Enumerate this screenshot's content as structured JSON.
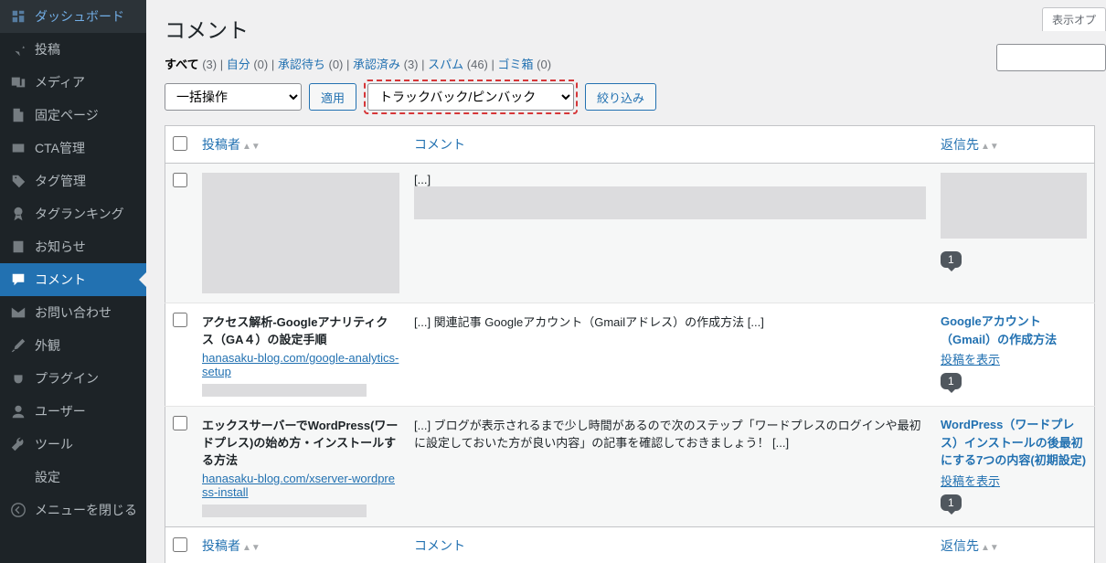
{
  "sidebar": {
    "items": [
      {
        "icon": "dashboard",
        "label": "ダッシュボード"
      },
      {
        "icon": "pin",
        "label": "投稿"
      },
      {
        "icon": "media",
        "label": "メディア"
      },
      {
        "icon": "page",
        "label": "固定ページ"
      },
      {
        "icon": "cta",
        "label": "CTA管理"
      },
      {
        "icon": "tag",
        "label": "タグ管理"
      },
      {
        "icon": "award",
        "label": "タグランキング"
      },
      {
        "icon": "notice",
        "label": "お知らせ"
      },
      {
        "icon": "comment",
        "label": "コメント"
      },
      {
        "icon": "mail",
        "label": "お問い合わせ"
      },
      {
        "icon": "brush",
        "label": "外観"
      },
      {
        "icon": "plugin",
        "label": "プラグイン"
      },
      {
        "icon": "user",
        "label": "ユーザー"
      },
      {
        "icon": "tool",
        "label": "ツール"
      },
      {
        "icon": "settings",
        "label": "設定"
      },
      {
        "icon": "collapse",
        "label": "メニューを閉じる"
      }
    ],
    "current_index": 8
  },
  "header": {
    "title": "コメント",
    "screen_options": "表示オプ"
  },
  "filters": {
    "tabs": [
      {
        "label": "すべて",
        "count": "(3)",
        "current": true
      },
      {
        "label": "自分",
        "count": "(0)"
      },
      {
        "label": "承認待ち",
        "count": "(0)"
      },
      {
        "label": "承認済み",
        "count": "(3)"
      },
      {
        "label": "スパム",
        "count": "(46)"
      },
      {
        "label": "ゴミ箱",
        "count": "(0)"
      }
    ],
    "bulk_action": "一括操作",
    "apply": "適用",
    "comment_type": "トラックバック/ピンバック",
    "filter_btn": "絞り込み"
  },
  "table": {
    "columns": {
      "author": "投稿者",
      "comment": "コメント",
      "reply": "返信先"
    },
    "rows": [
      {
        "author_title": "",
        "author_url": "",
        "comment_excerpt": "[...]",
        "reply_title": "",
        "reply_view": "",
        "count": "1",
        "redacted": true
      },
      {
        "author_title": "アクセス解析-Googleアナリティクス（GA４）の設定手順",
        "author_url": "hanasaku-blog.com/google-analytics-setup",
        "comment_excerpt": "[...] 関連記事 Googleアカウント（Gmailアドレス）の作成方法 [...]",
        "reply_title": "Googleアカウント（Gmail）の作成方法",
        "reply_view": "投稿を表示",
        "count": "1"
      },
      {
        "author_title": "エックスサーバーでWordPress(ワードプレス)の始め方・インストールする方法",
        "author_url": "hanasaku-blog.com/xserver-wordpress-install",
        "comment_excerpt": "[...] ブログが表示されるまで少し時間があるので次のステップ「ワードプレスのログインや最初に設定しておいた方が良い内容」の記事を確認しておきましょう！ [...]",
        "reply_title": "WordPress（ワードプレス）インストールの後最初にする7つの内容(初期設定)",
        "reply_view": "投稿を表示",
        "count": "1"
      }
    ]
  }
}
